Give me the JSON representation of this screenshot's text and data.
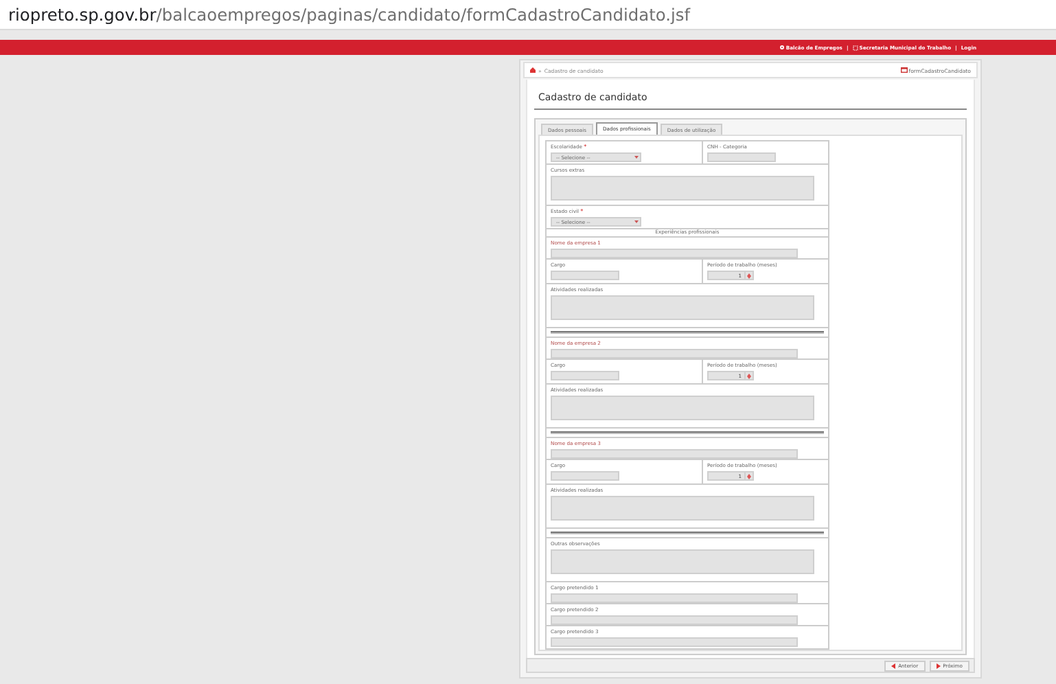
{
  "address_bar": {
    "host": "riopreto.sp.gov.br",
    "path": "/balcaoempregos/paginas/candidato/formCadastroCandidato.jsf"
  },
  "top_links": {
    "separator": "|",
    "items": [
      "Balcão de Empregos",
      "Secretaria Municipal do Trabalho",
      "Login"
    ]
  },
  "breadcrumb": {
    "separator": "»",
    "current": "Cadastro de candidato",
    "page": "formCadastroCandidato"
  },
  "title": "Cadastro de candidato",
  "tabs": [
    {
      "label": "Dados pessoais",
      "selected": false
    },
    {
      "label": "Dados profissionais",
      "selected": true
    },
    {
      "label": "Dados de utilização",
      "selected": false
    }
  ],
  "form": {
    "rows": [
      {
        "kind": "pair",
        "fields": [
          {
            "kind": "select",
            "label": "Escolaridade",
            "required_mark": "*",
            "value": "-- Selecione --"
          },
          {
            "kind": "short",
            "label": "CNH - Categoria"
          }
        ]
      },
      {
        "kind": "single",
        "fields": [
          {
            "kind": "textarea",
            "label": "Cursos extras"
          }
        ]
      },
      {
        "kind": "single",
        "fields": [
          {
            "kind": "select",
            "label": "Estado civil",
            "required_mark": "*",
            "value": "-- Selecione --"
          }
        ]
      },
      {
        "kind": "header",
        "text": "Experiências profissionais"
      },
      {
        "kind": "single",
        "fields": [
          {
            "kind": "text",
            "label": "Nome da empresa 1",
            "emphasized": true
          }
        ]
      },
      {
        "kind": "pair",
        "fields": [
          {
            "kind": "short",
            "label": "Cargo"
          },
          {
            "kind": "spinner",
            "label": "Período de trabalho (meses)",
            "value": "1"
          }
        ]
      },
      {
        "kind": "single",
        "fields": [
          {
            "kind": "textarea",
            "label": "Atividades realizadas"
          }
        ]
      },
      {
        "kind": "separator"
      },
      {
        "kind": "single",
        "fields": [
          {
            "kind": "text",
            "label": "Nome da empresa 2",
            "emphasized": true
          }
        ]
      },
      {
        "kind": "pair",
        "fields": [
          {
            "kind": "short",
            "label": "Cargo"
          },
          {
            "kind": "spinner",
            "label": "Período de trabalho (meses)",
            "value": "1"
          }
        ]
      },
      {
        "kind": "single",
        "fields": [
          {
            "kind": "textarea",
            "label": "Atividades realizadas"
          }
        ]
      },
      {
        "kind": "separator"
      },
      {
        "kind": "single",
        "fields": [
          {
            "kind": "text",
            "label": "Nome da empresa 3",
            "emphasized": true
          }
        ]
      },
      {
        "kind": "pair",
        "fields": [
          {
            "kind": "short",
            "label": "Cargo"
          },
          {
            "kind": "spinner",
            "label": "Período de trabalho (meses)",
            "value": "1"
          }
        ]
      },
      {
        "kind": "single",
        "fields": [
          {
            "kind": "textarea",
            "label": "Atividades realizadas"
          }
        ]
      },
      {
        "kind": "separator"
      },
      {
        "kind": "single",
        "fields": [
          {
            "kind": "textarea",
            "label": "Outras observações"
          }
        ]
      },
      {
        "kind": "single",
        "fields": [
          {
            "kind": "text",
            "label": "Cargo pretendido 1"
          }
        ]
      },
      {
        "kind": "single",
        "fields": [
          {
            "kind": "text",
            "label": "Cargo pretendido 2"
          }
        ]
      },
      {
        "kind": "single",
        "fields": [
          {
            "kind": "text",
            "label": "Cargo pretendido 3"
          }
        ]
      }
    ]
  },
  "buttons": [
    {
      "label": "Anterior"
    },
    {
      "label": "Próximo"
    }
  ]
}
